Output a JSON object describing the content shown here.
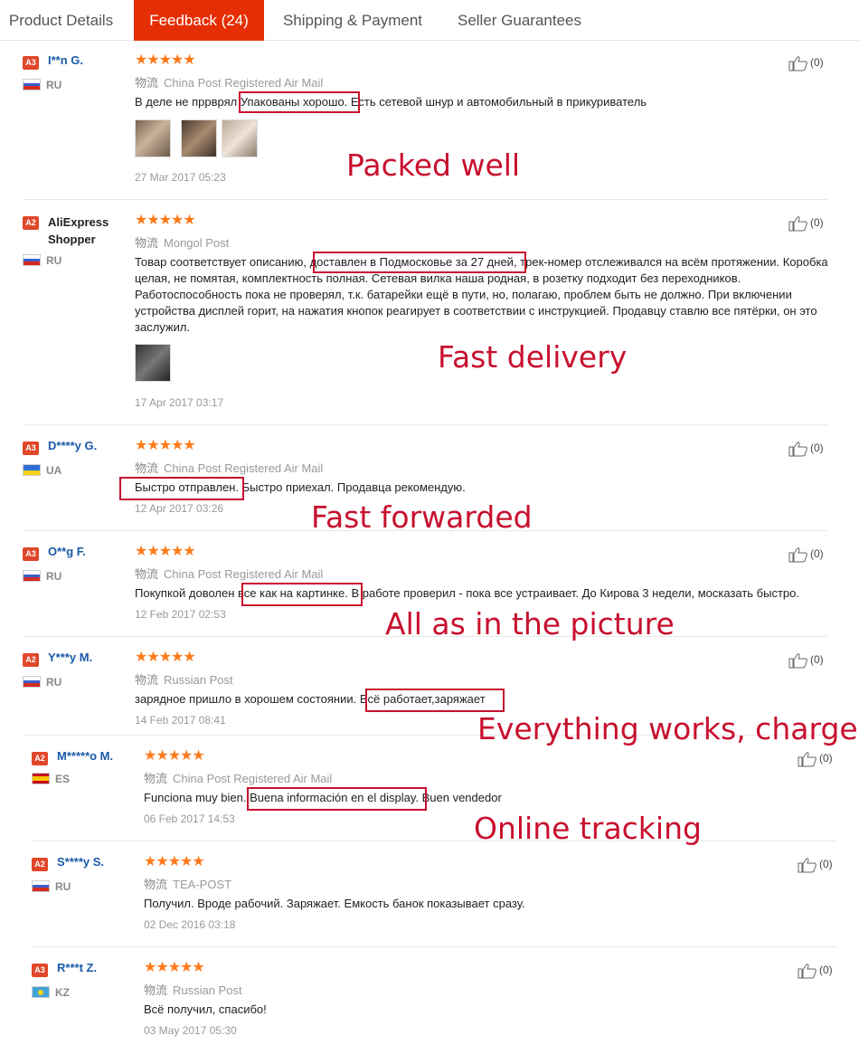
{
  "tabs": [
    {
      "label": "Product Details"
    },
    {
      "label": "Feedback (24)"
    },
    {
      "label": "Shipping & Payment"
    },
    {
      "label": "Seller Guarantees"
    }
  ],
  "shipping_prefix": "物流",
  "reviews": [
    {
      "level": "A3",
      "name": "I**n G.",
      "country": "RU",
      "rating": 5,
      "shipping": "China Post Registered Air Mail",
      "text": "В деле не пррврял Упакованы хорошо. Есть сетевой шнур и автомобильный в прикуриватель",
      "date": "27 Mar 2017 05:23",
      "likes": "(0)"
    },
    {
      "level": "A2",
      "name": "AliExpress Shopper",
      "country": "RU",
      "rating": 5,
      "shipping": "Mongol Post",
      "text": "Товар соответствует описанию, доставлен в Подмосковье за 27 дней, трек-номер отслеживался на всём протяжении. Коробка целая, не помятая, комплектность полная. Сетевая вилка наша родная, в розетку подходит без переходников. Работоспособность пока не проверял, т.к. батарейки ещё в пути, но, полагаю, проблем быть не должно. При включении устройства дисплей горит, на нажатия кнопок реагирует в соответствии с инструкцией. Продавцу ставлю все пятёрки, он это заслужил.",
      "date": "17 Apr 2017 03:17",
      "likes": "(0)"
    },
    {
      "level": "A3",
      "name": "D****y G.",
      "country": "UA",
      "rating": 5,
      "shipping": "China Post Registered Air Mail",
      "text": "Быстро отправлен. Быстро приехал. Продавца рекомендую.",
      "date": "12 Apr 2017 03:26",
      "likes": "(0)"
    },
    {
      "level": "A3",
      "name": "O**g F.",
      "country": "RU",
      "rating": 5,
      "shipping": "China Post Registered Air Mail",
      "text": "Покупкой доволен все как на картинке. В работе проверил - пока все устраивает. До Кирова 3 недели, москазать быстро.",
      "date": "12 Feb 2017 02:53",
      "likes": "(0)"
    },
    {
      "level": "A2",
      "name": "Y***y M.",
      "country": "RU",
      "rating": 5,
      "shipping": "Russian Post",
      "text": "зарядное пришло в хорошем состоянии. Всё работает,заряжает",
      "date": "14 Feb 2017 08:41",
      "likes": "(0)"
    },
    {
      "level": "A2",
      "name": "M*****o M.",
      "country": "ES",
      "rating": 5,
      "shipping": "China Post Registered Air Mail",
      "text": "Funciona muy bien. Buena información en el display. Buen vendedor",
      "date": "06 Feb 2017 14:53",
      "likes": "(0)"
    },
    {
      "level": "A2",
      "name": "S****y S.",
      "country": "RU",
      "rating": 5,
      "shipping": "TEA-POST",
      "text": "Получил. Вроде рабочий. Заряжает. Емкость банок показывает сразу.",
      "date": "02 Dec 2016 03:18",
      "likes": "(0)"
    },
    {
      "level": "A3",
      "name": "R***t Z.",
      "country": "KZ",
      "rating": 5,
      "shipping": "Russian Post",
      "text": "Всё получил, спасибо!",
      "date": "03 May 2017 05:30",
      "likes": "(0)"
    }
  ],
  "annotations": [
    "Packed well",
    "Fast delivery",
    "Fast forwarded",
    "All as in the picture",
    "Everything works, charges",
    "Online tracking"
  ],
  "colors": {
    "accent": "#e62e04",
    "star": "#ff7a1a",
    "username": "#1a5aa9",
    "annotation": "#c8102e"
  }
}
